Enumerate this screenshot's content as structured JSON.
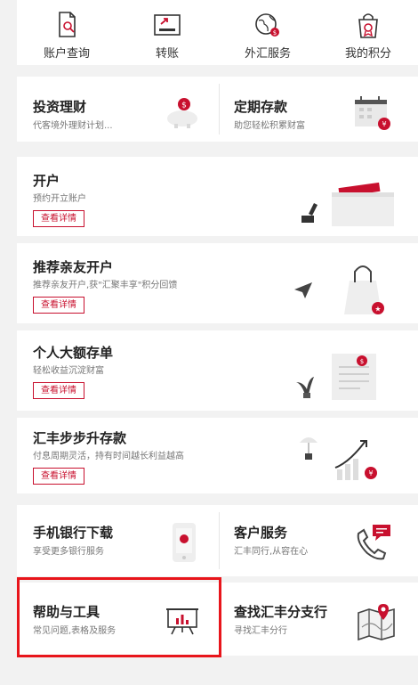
{
  "quick_nav": [
    {
      "label": "账户查询",
      "icon": "account-search-icon"
    },
    {
      "label": "转账",
      "icon": "transfer-icon"
    },
    {
      "label": "外汇服务",
      "icon": "fx-globe-icon"
    },
    {
      "label": "我的积分",
      "icon": "points-bag-icon"
    }
  ],
  "invest": {
    "title": "投资理财",
    "subtitle": "代客境外理财计划..."
  },
  "fixed_deposit": {
    "title": "定期存款",
    "subtitle": "助您轻松积累财富"
  },
  "open_account": {
    "title": "开户",
    "subtitle": "预约开立账户",
    "button": "查看详情"
  },
  "referral": {
    "title": "推荐亲友开户",
    "subtitle": "推荐亲友开户,获\"汇聚丰享\"积分回馈",
    "button": "查看详情"
  },
  "large_deposit": {
    "title": "个人大额存单",
    "subtitle": "轻松收益沉淀财富",
    "button": "查看详情"
  },
  "step_up": {
    "title": "汇丰步步升存款",
    "subtitle": "付息周期灵活，持有时间越长利益越高",
    "button": "查看详情"
  },
  "mobile_app": {
    "title": "手机银行下载",
    "subtitle": "享受更多银行服务"
  },
  "customer_service": {
    "title": "客户服务",
    "subtitle": "汇丰同行,从容在心"
  },
  "help_tools": {
    "title": "帮助与工具",
    "subtitle": "常见问题,表格及服务"
  },
  "branch_finder": {
    "title": "查找汇丰分支行",
    "subtitle": "寻找汇丰分行"
  },
  "colors": {
    "accent": "#c8102e",
    "highlight": "#e8151b"
  }
}
